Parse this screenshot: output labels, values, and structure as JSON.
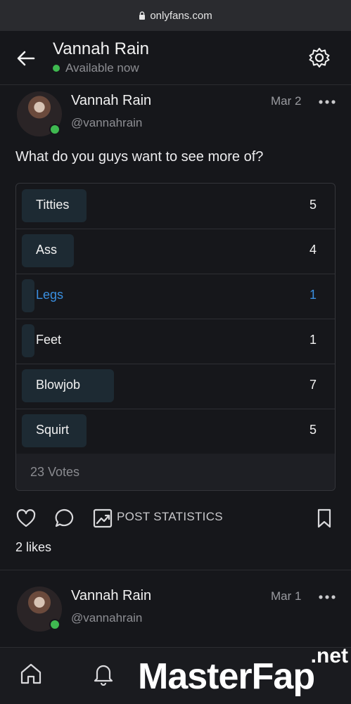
{
  "browser": {
    "url": "onlyfans.com"
  },
  "header": {
    "title": "Vannah Rain",
    "status": "Available now"
  },
  "post1": {
    "name": "Vannah Rain",
    "handle": "@vannahrain",
    "date": "Mar 2",
    "text": "What do you guys want to see more of?",
    "poll": {
      "options": [
        {
          "label": "Titties",
          "count": "5",
          "fraction": 0.21
        },
        {
          "label": "Ass",
          "count": "4",
          "fraction": 0.17
        },
        {
          "label": "Legs",
          "count": "1",
          "fraction": 0.04,
          "selected": true
        },
        {
          "label": "Feet",
          "count": "1",
          "fraction": 0.04
        },
        {
          "label": "Blowjob",
          "count": "7",
          "fraction": 0.3
        },
        {
          "label": "Squirt",
          "count": "5",
          "fraction": 0.21
        }
      ],
      "votes": "23 Votes"
    },
    "actions": {
      "stats_label": "POST STATISTICS"
    },
    "likes": "2 likes"
  },
  "post2": {
    "name": "Vannah Rain",
    "handle": "@vannahrain",
    "date": "Mar 1"
  },
  "watermark": {
    "main": "MasterFap",
    "suffix": ".net"
  },
  "colors": {
    "background": "#16171b",
    "accent": "#3a8fe0",
    "online": "#3fb950"
  }
}
